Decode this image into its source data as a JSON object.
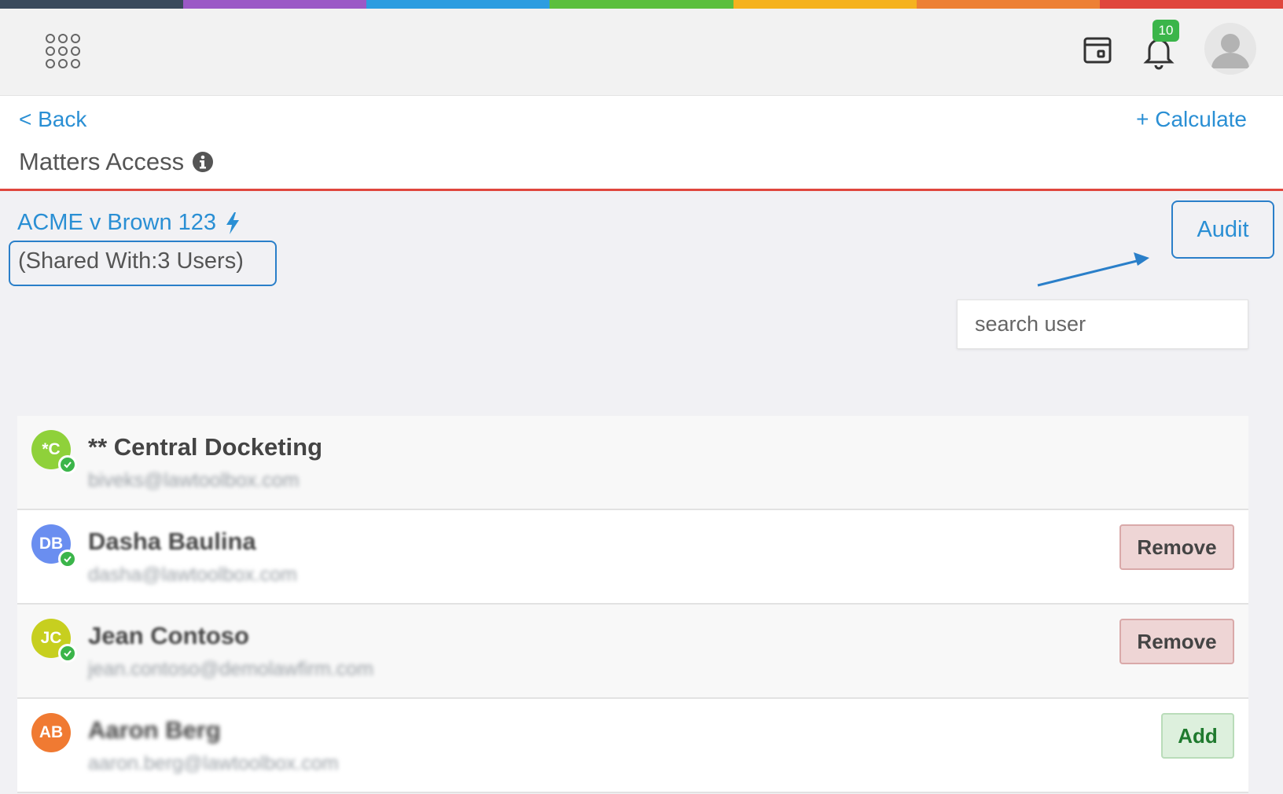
{
  "rainbow_colors": [
    "#3a4a5c",
    "#9b59c6",
    "#2d9de0",
    "#5bbf3e",
    "#f5b21f",
    "#ed8034",
    "#e0463d"
  ],
  "topbar": {
    "apps_icon": "grid-dots-icon",
    "calendar_icon": "calendar-icon",
    "bell_icon": "bell-icon",
    "notification_count": "10",
    "avatar_icon": "user-avatar-icon"
  },
  "header": {
    "back_label": "< Back",
    "calculate_label": "+ Calculate",
    "title": "Matters Access",
    "info_icon": "info-icon"
  },
  "matter": {
    "name": "ACME v Brown 123",
    "shared_text": "(Shared With:3 Users)",
    "audit_label": "Audit"
  },
  "search": {
    "placeholder": "search user"
  },
  "users": [
    {
      "initials": "*C",
      "name": "** Central Docketing",
      "email": "biveks@lawtoolbox.com",
      "color": "#8fd13a",
      "verified": true,
      "action": ""
    },
    {
      "initials": "DB",
      "name": "Dasha Baulina",
      "email": "dasha@lawtoolbox.com",
      "color": "#6a8ef0",
      "verified": true,
      "action": "Remove"
    },
    {
      "initials": "JC",
      "name": "Jean Contoso",
      "email": "jean.contoso@demolawfirm.com",
      "color": "#c7cf1f",
      "verified": true,
      "action": "Remove"
    },
    {
      "initials": "AB",
      "name": "Aaron Berg",
      "email": "aaron.berg@lawtoolbox.com",
      "color": "#f07a32",
      "verified": false,
      "action": "Add"
    }
  ]
}
